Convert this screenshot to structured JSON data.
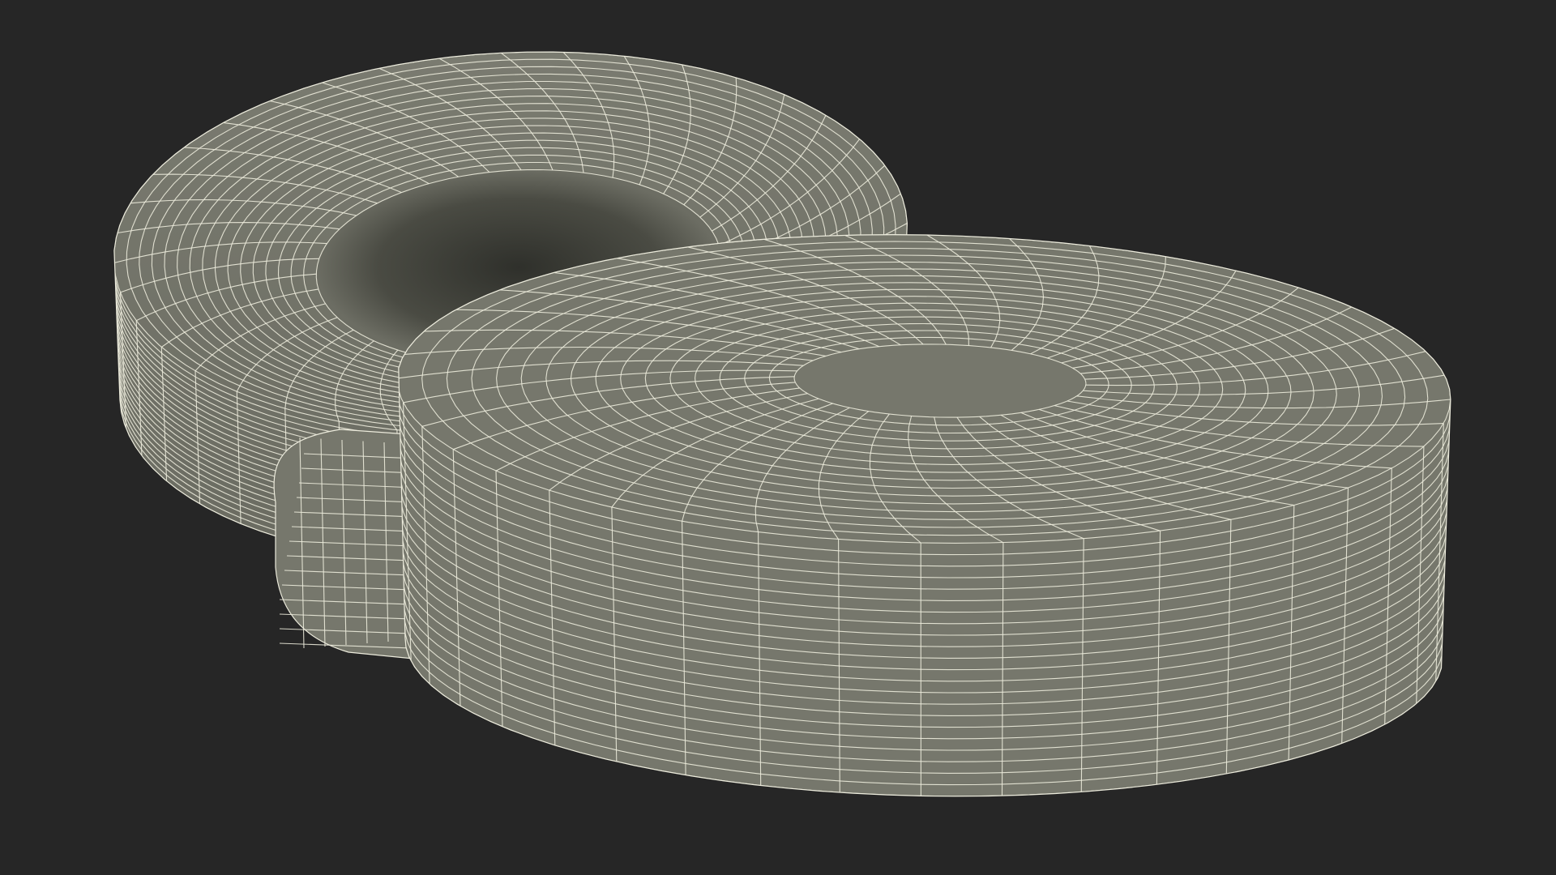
{
  "scene": {
    "background_color": "#262626",
    "surface_color": "#76776c",
    "surface_shadow_color": "#3b3c35",
    "wire_color": "#ecebdc",
    "objects": [
      {
        "name": "back-torus",
        "kind": "wireframe-torus",
        "position": "back-left"
      },
      {
        "name": "front-torus",
        "kind": "wireframe-torus",
        "position": "front-right"
      }
    ]
  }
}
